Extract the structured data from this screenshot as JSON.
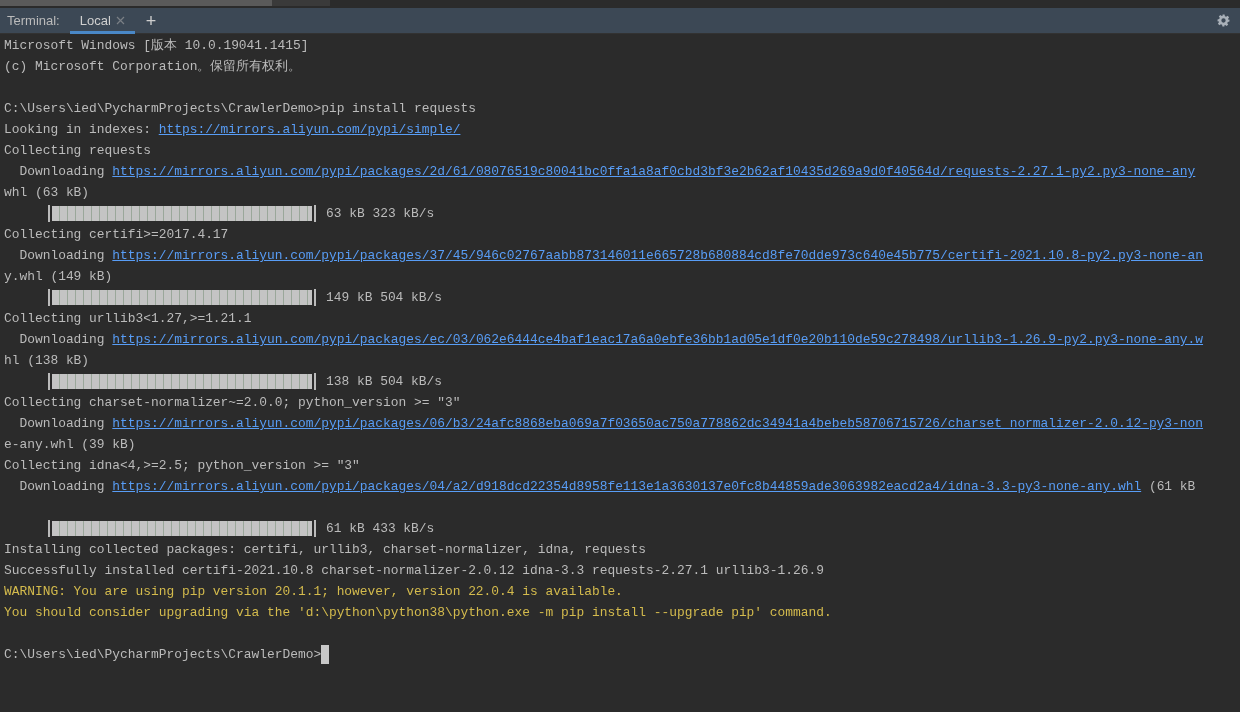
{
  "tool_window": {
    "title": "Terminal:",
    "tabs": [
      {
        "label": "Local",
        "selected": true
      }
    ],
    "new_tab": "+"
  },
  "lines": [
    {
      "kind": "text",
      "text": "Microsoft Windows [版本 10.0.19041.1415]"
    },
    {
      "kind": "text",
      "text": "(c) Microsoft Corporation。保留所有权利。"
    },
    {
      "kind": "blank"
    },
    {
      "kind": "text",
      "text": "C:\\Users\\ied\\PycharmProjects\\CrawlerDemo>pip install requests"
    },
    {
      "kind": "link",
      "prefix": "Looking in indexes: ",
      "url": "https://mirrors.aliyun.com/pypi/simple/"
    },
    {
      "kind": "text",
      "text": "Collecting requests"
    },
    {
      "kind": "link",
      "prefix": "  Downloading ",
      "url": "https://mirrors.aliyun.com/pypi/packages/2d/61/08076519c80041bc0ffa1a8af0cbd3bf3e2b62af10435d269a9d0f40564d/requests-2.27.1-py2.py3-none-any"
    },
    {
      "kind": "text",
      "text": "whl (63 kB)"
    },
    {
      "kind": "progress",
      "level": 1,
      "text": "63 kB 323 kB/s"
    },
    {
      "kind": "text",
      "text": "Collecting certifi>=2017.4.17"
    },
    {
      "kind": "link",
      "prefix": "  Downloading ",
      "url": "https://mirrors.aliyun.com/pypi/packages/37/45/946c02767aabb873146011e665728b680884cd8fe70dde973c640e45b775/certifi-2021.10.8-py2.py3-none-an"
    },
    {
      "kind": "text",
      "text": "y.whl (149 kB)"
    },
    {
      "kind": "progress",
      "level": 1,
      "text": "149 kB 504 kB/s"
    },
    {
      "kind": "text",
      "text": "Collecting urllib3<1.27,>=1.21.1"
    },
    {
      "kind": "link",
      "prefix": "  Downloading ",
      "url": "https://mirrors.aliyun.com/pypi/packages/ec/03/062e6444ce4baf1eac17a6a0ebfe36bb1ad05e1df0e20b110de59c278498/urllib3-1.26.9-py2.py3-none-any.w"
    },
    {
      "kind": "text",
      "text": "hl (138 kB)"
    },
    {
      "kind": "progress",
      "level": 1,
      "text": "138 kB 504 kB/s"
    },
    {
      "kind": "text",
      "text": "Collecting charset-normalizer~=2.0.0; python_version >= \"3\""
    },
    {
      "kind": "link",
      "prefix": "  Downloading ",
      "url": "https://mirrors.aliyun.com/pypi/packages/06/b3/24afc8868eba069a7f03650ac750a778862dc34941a4bebeb58706715726/charset_normalizer-2.0.12-py3-non"
    },
    {
      "kind": "text",
      "text": "e-any.whl (39 kB)"
    },
    {
      "kind": "text",
      "text": "Collecting idna<4,>=2.5; python_version >= \"3\""
    },
    {
      "kind": "link",
      "prefix": "  Downloading ",
      "url": "https://mirrors.aliyun.com/pypi/packages/04/a2/d918dcd22354d8958fe113e1a3630137e0fc8b44859ade3063982eacd2a4/idna-3.3-py3-none-any.whl",
      "suffix": " (61 kB"
    },
    {
      "kind": "blank"
    },
    {
      "kind": "progress",
      "level": 1,
      "text": "61 kB 433 kB/s"
    },
    {
      "kind": "text",
      "text": "Installing collected packages: certifi, urllib3, charset-normalizer, idna, requests"
    },
    {
      "kind": "text",
      "text": "Successfully installed certifi-2021.10.8 charset-normalizer-2.0.12 idna-3.3 requests-2.27.1 urllib3-1.26.9"
    },
    {
      "kind": "warning",
      "text": "WARNING: You are using pip version 20.1.1; however, version 22.0.4 is available."
    },
    {
      "kind": "warning",
      "text": "You should consider upgrading via the 'd:\\python\\python38\\python.exe -m pip install --upgrade pip' command."
    },
    {
      "kind": "blank"
    },
    {
      "kind": "prompt",
      "text": "C:\\Users\\ied\\PycharmProjects\\CrawlerDemo>"
    }
  ]
}
